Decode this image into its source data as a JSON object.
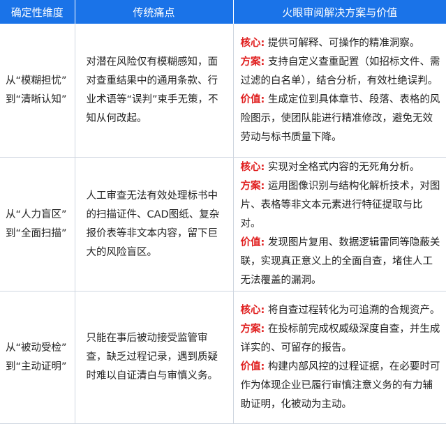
{
  "header": {
    "col1": "确定性维度",
    "col2": "传统痛点",
    "col3": "火眼审阅解决方案与价值"
  },
  "rows": [
    {
      "dimension_line1": "从“模糊担忧”",
      "dimension_line2": "到“清晰认知”",
      "pain": "对潜在风险仅有模糊感知，面对查重结果中的通用条款、行业术语等“误判”束手无策，不知从何改起。",
      "solution": [
        {
          "label": "核心:",
          "text": " 提供可解释、可操作的精准洞察。"
        },
        {
          "label": "方案:",
          "text": " 支持自定义查重配置（如招标文件、需过滤的白名单），结合分析，有效杜绝误判。"
        },
        {
          "label": "价值:",
          "text": " 生成定位到具体章节、段落、表格的风险图示，使团队能进行精准修改，避免无效劳动与标书质量下降。"
        }
      ]
    },
    {
      "dimension_line1": "从“人力盲区”",
      "dimension_line2": "到“全面扫描”",
      "pain": "人工审查无法有效处理标书中的扫描证件、CAD图纸、复杂报价表等非文本内容，留下巨大的风险盲区。",
      "solution": [
        {
          "label": "核心:",
          "text": " 实现对全格式内容的无死角分析。"
        },
        {
          "label": "方案:",
          "text": " 运用图像识别与结构化解析技术，对图片、表格等非文本元素进行特征提取与比对。"
        },
        {
          "label": "价值:",
          "text": " 发现图片复用、数据逻辑雷同等隐蔽关联，实现真正意义上的全面自查，堵住人工无法覆盖的漏洞。"
        }
      ]
    },
    {
      "dimension_line1": "从“被动受检”",
      "dimension_line2": "到“主动证明”",
      "pain": "只能在事后被动接受监管审查，缺乏过程记录，遇到质疑时难以自证清白与审慎义务。",
      "solution": [
        {
          "label": "核心:",
          "text": " 将自查过程转化为可追溯的合规资产。"
        },
        {
          "label": "方案:",
          "text": " 在投标前完成权威级深度自查，并生成详实的、可留存的报告。"
        },
        {
          "label": "价值:",
          "text": " 构建内部风控的过程证据，在必要时可作为体现企业已履行审慎注意义务的有力辅助证明，化被动为主动。"
        }
      ]
    }
  ]
}
